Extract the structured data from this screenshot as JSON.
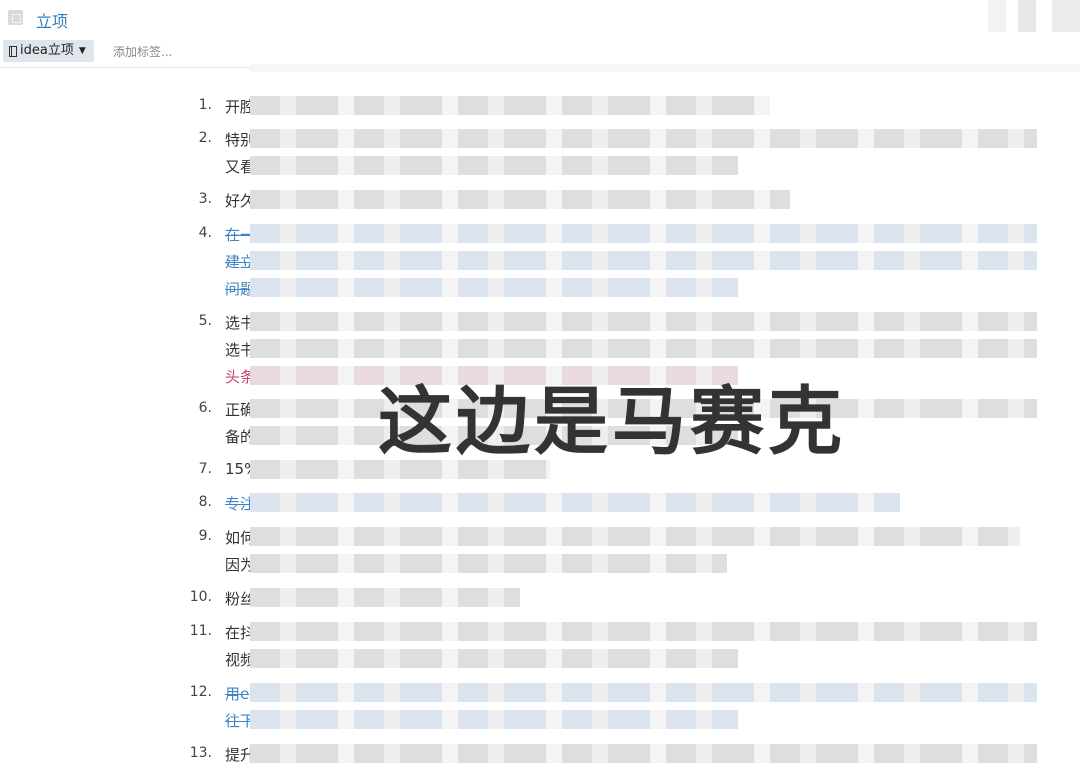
{
  "note": {
    "title": "立项"
  },
  "tagbar": {
    "notebook": "idea立项",
    "add_tag": "添加标签..."
  },
  "items": [
    {
      "num": "1.",
      "lines": [
        {
          "text": "开腔",
          "style": ""
        }
      ]
    },
    {
      "num": "2.",
      "lines": [
        {
          "text": "特别",
          "style": ""
        },
        {
          "text": "又看",
          "style": ""
        }
      ]
    },
    {
      "num": "3.",
      "lines": [
        {
          "text": "好久",
          "style": ""
        }
      ]
    },
    {
      "num": "4.",
      "lines": [
        {
          "text": "在一",
          "style": "struck"
        },
        {
          "text": "建立",
          "style": "struck"
        },
        {
          "text": "问题",
          "style": "struck"
        }
      ]
    },
    {
      "num": "5.",
      "lines": [
        {
          "text": "选书",
          "style": ""
        },
        {
          "text": "选书",
          "style": ""
        },
        {
          "text": "头条",
          "style": "pink"
        }
      ]
    },
    {
      "num": "6.",
      "lines": [
        {
          "text": "正确",
          "style": ""
        },
        {
          "text": "备的",
          "style": ""
        }
      ]
    },
    {
      "num": "7.",
      "lines": [
        {
          "text": "15%",
          "style": ""
        }
      ]
    },
    {
      "num": "8.",
      "lines": [
        {
          "text": "专注",
          "style": "struck"
        }
      ]
    },
    {
      "num": "9.",
      "lines": [
        {
          "text": "如何",
          "style": ""
        },
        {
          "text": "因为",
          "style": ""
        }
      ]
    },
    {
      "num": "10.",
      "lines": [
        {
          "text": "粉丝",
          "style": ""
        }
      ]
    },
    {
      "num": "11.",
      "lines": [
        {
          "text": "在抖",
          "style": ""
        },
        {
          "text": "视频",
          "style": ""
        }
      ]
    },
    {
      "num": "12.",
      "lines": [
        {
          "text": "用e",
          "style": "struck"
        },
        {
          "text": "往下",
          "style": "struck"
        }
      ]
    },
    {
      "num": "13.",
      "lines": [
        {
          "text": "提升",
          "style": ""
        }
      ]
    }
  ],
  "watermark": "这边是马赛克",
  "colors": {
    "link_blue": "#2f7fc0",
    "struck_blue": "#3d85c6",
    "pill_bg": "#dfe5ec"
  }
}
